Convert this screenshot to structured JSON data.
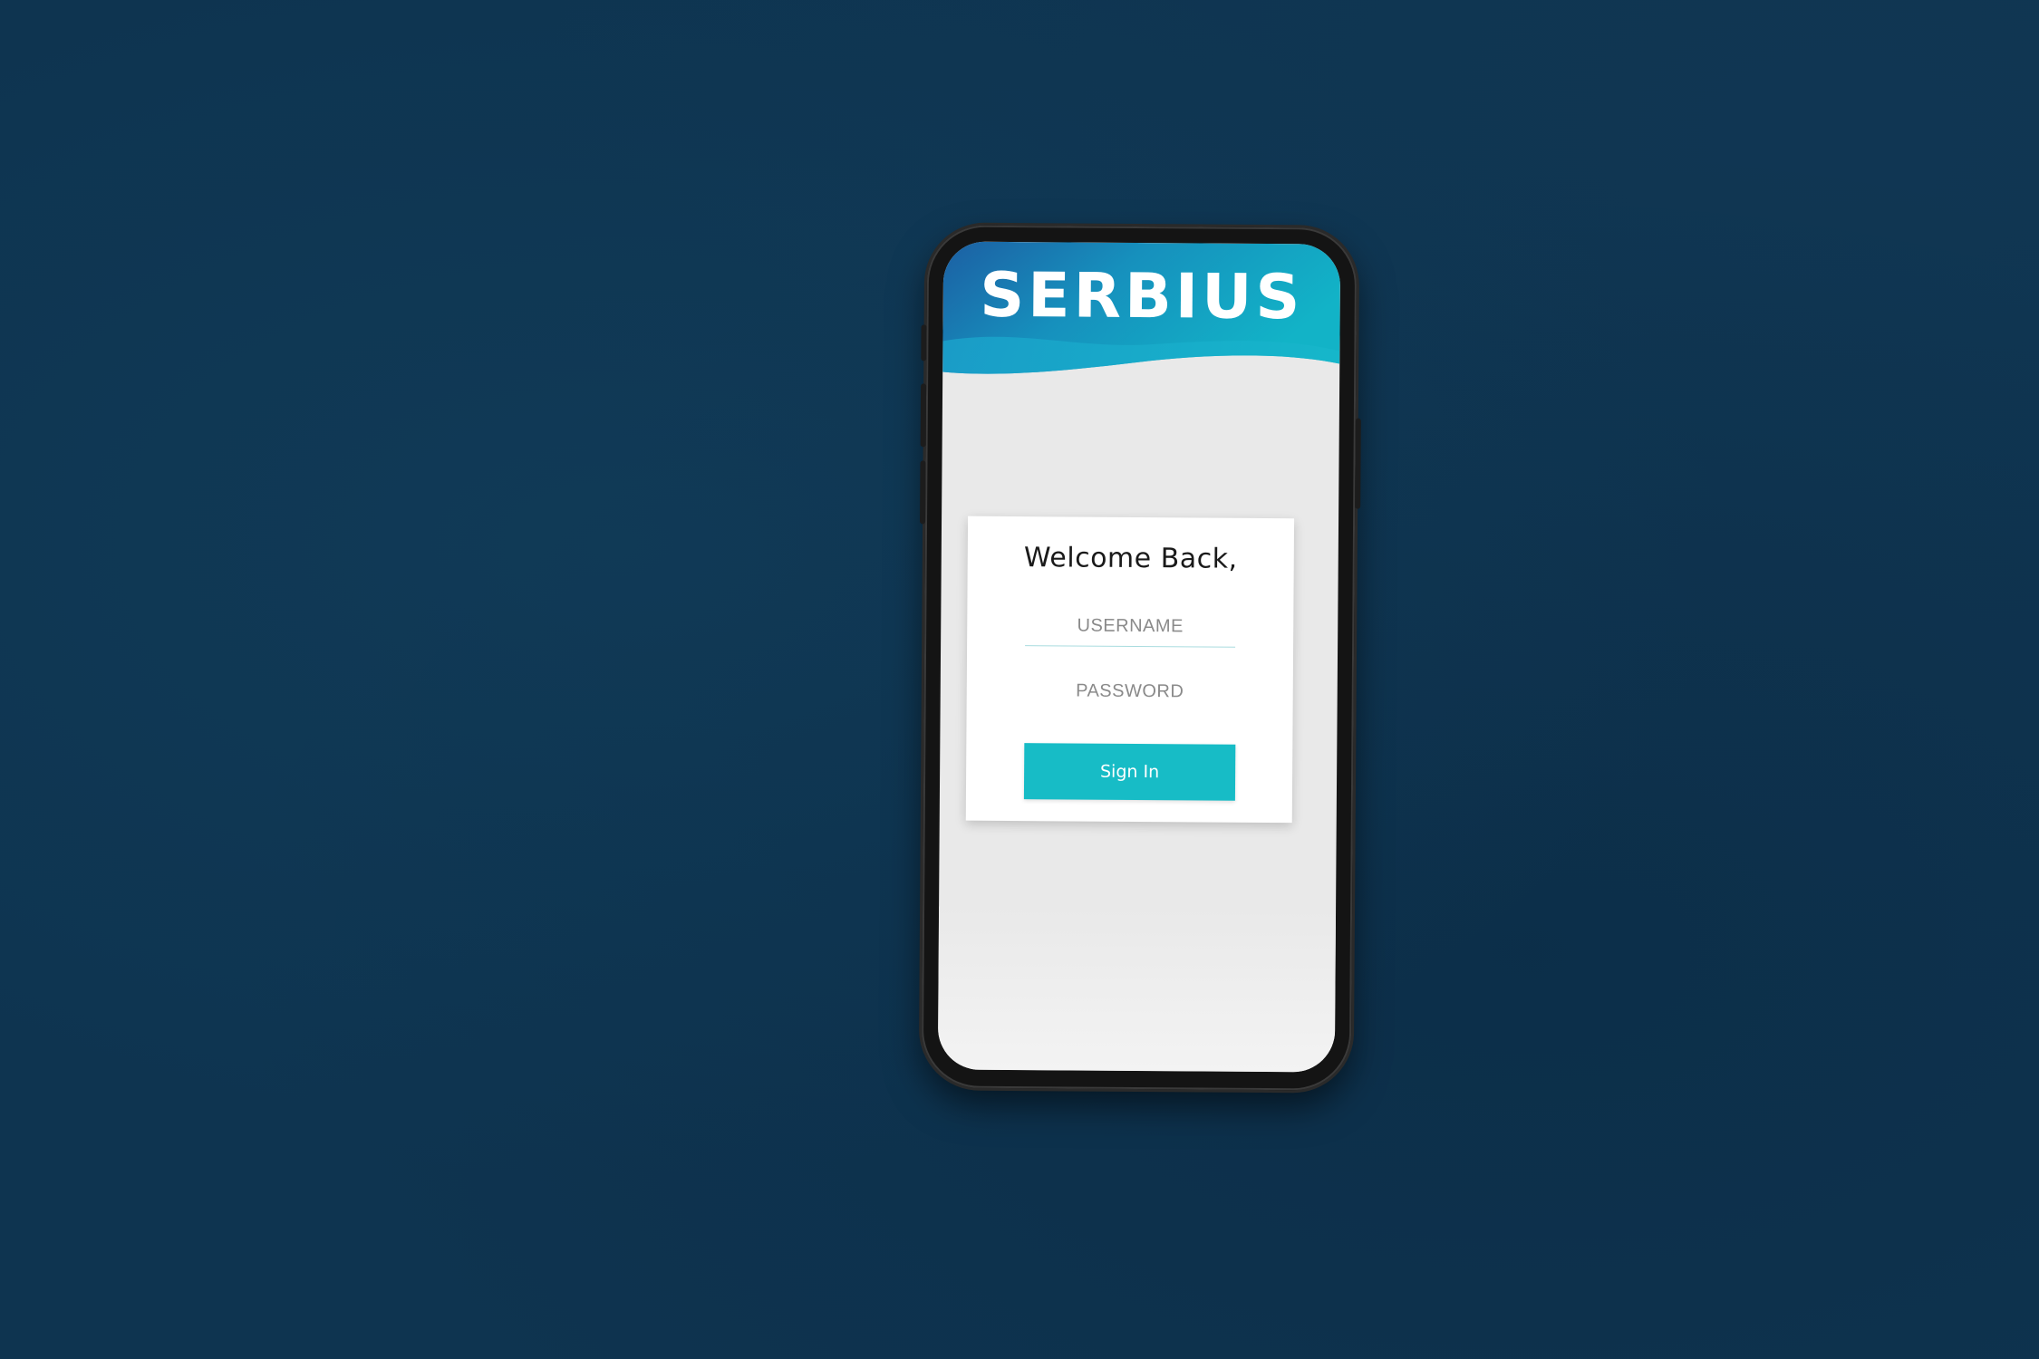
{
  "app": {
    "logo_text": "SERBIUS"
  },
  "login": {
    "welcome_text": "Welcome Back,",
    "username_placeholder": "USERNAME",
    "password_placeholder": "PASSWORD",
    "username_value": "",
    "password_value": "",
    "signin_label": "Sign In"
  },
  "colors": {
    "background": "#0e3450",
    "header_dark": "#1c6aa6",
    "header_light": "#14a9c4",
    "screen_bg": "#e9e9e9",
    "accent_button": "#17bcc6",
    "underline": "#a9dcdf"
  }
}
